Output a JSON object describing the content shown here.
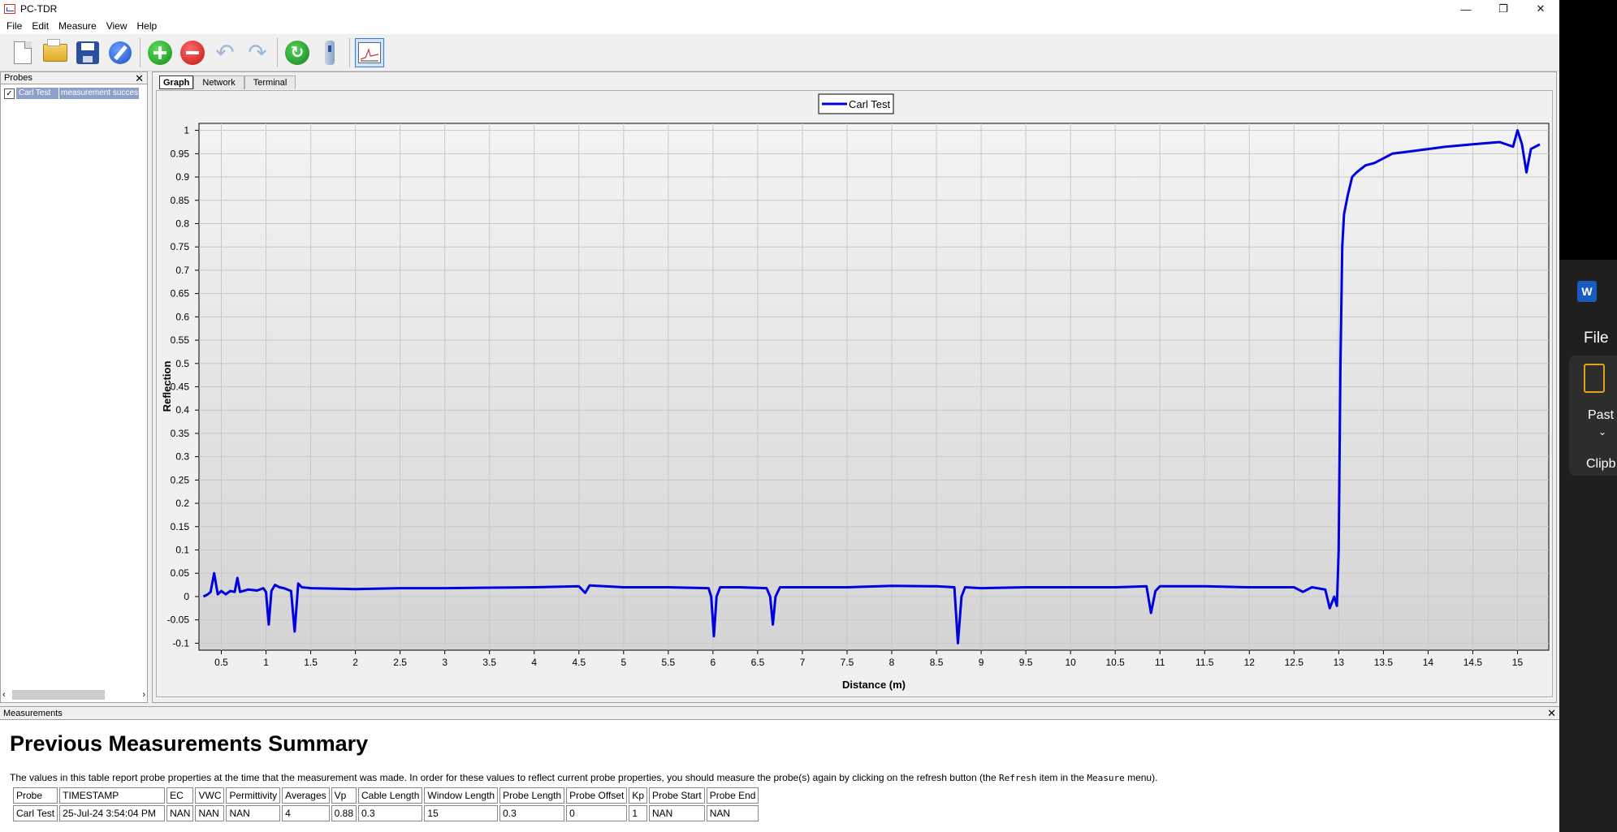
{
  "window": {
    "title": "PC-TDR",
    "controls": {
      "minimize": "—",
      "restore": "❐",
      "close": "✕"
    }
  },
  "menu": [
    "File",
    "Edit",
    "Measure",
    "View",
    "Help"
  ],
  "toolbar": {
    "icons": [
      "new-file-icon",
      "open-folder-icon",
      "save-icon",
      "edit-icon",
      "add-icon",
      "remove-icon",
      "undo-icon",
      "redo-icon",
      "refresh-icon",
      "probe-icon",
      "graph-icon"
    ]
  },
  "probes_panel": {
    "title": "Probes",
    "close": "✕",
    "rows": [
      {
        "name": "Carl Test",
        "status": "measurement successful",
        "checked": "✓"
      }
    ],
    "scroll_left": "‹",
    "scroll_right": "›"
  },
  "tabs": [
    {
      "label": "Graph",
      "active": true
    },
    {
      "label": "Network"
    },
    {
      "label": "Terminal"
    }
  ],
  "chart_data": {
    "type": "line",
    "xlabel": "Distance (m)",
    "ylabel": "Reflection",
    "xlim": [
      0.25,
      15.35
    ],
    "ylim": [
      -0.115,
      1.015
    ],
    "grid": true,
    "legend_position": "top-center",
    "x_ticks": [
      0.5,
      1,
      1.5,
      2,
      2.5,
      3,
      3.5,
      4,
      4.5,
      5,
      5.5,
      6,
      6.5,
      7,
      7.5,
      8,
      8.5,
      9,
      9.5,
      10,
      10.5,
      11,
      11.5,
      12,
      12.5,
      13,
      13.5,
      14,
      14.5,
      15
    ],
    "x_tick_labels": [
      "0.5",
      "1",
      "1.5",
      "2",
      "2.5",
      "3",
      "3.5",
      "4",
      "4.5",
      "5",
      "5.5",
      "6",
      "6.5",
      "7",
      "7.5",
      "8",
      "8.5",
      "9",
      "9.5",
      "10",
      "10.5",
      "11",
      "11.5",
      "12",
      "12.5",
      "13",
      "13.5",
      "14",
      "14.5",
      "15"
    ],
    "y_ticks": [
      -0.1,
      -0.05,
      0,
      0.05,
      0.1,
      0.15,
      0.2,
      0.25,
      0.3,
      0.35,
      0.4,
      0.45,
      0.5,
      0.55,
      0.6,
      0.65,
      0.7,
      0.75,
      0.8,
      0.85,
      0.9,
      0.95,
      1
    ],
    "y_tick_labels": [
      "-0.1",
      "-0.05",
      "0",
      "0.05",
      "0.1",
      "0.15",
      "0.2",
      "0.25",
      "0.3",
      "0.35",
      "0.4",
      "0.45",
      "0.5",
      "0.55",
      "0.6",
      "0.65",
      "0.7",
      "0.75",
      "0.8",
      "0.85",
      "0.9",
      "0.95",
      "1"
    ],
    "series": [
      {
        "name": "Carl Test",
        "color": "#0000e0",
        "points": [
          [
            0.3,
            0.0
          ],
          [
            0.35,
            0.005
          ],
          [
            0.38,
            0.01
          ],
          [
            0.42,
            0.05
          ],
          [
            0.46,
            0.005
          ],
          [
            0.5,
            0.012
          ],
          [
            0.55,
            0.005
          ],
          [
            0.6,
            0.012
          ],
          [
            0.65,
            0.01
          ],
          [
            0.68,
            0.04
          ],
          [
            0.71,
            0.01
          ],
          [
            0.8,
            0.015
          ],
          [
            0.9,
            0.013
          ],
          [
            0.97,
            0.018
          ],
          [
            1.0,
            0.01
          ],
          [
            1.03,
            -0.06
          ],
          [
            1.06,
            0.012
          ],
          [
            1.1,
            0.025
          ],
          [
            1.15,
            0.02
          ],
          [
            1.2,
            0.018
          ],
          [
            1.28,
            0.012
          ],
          [
            1.32,
            -0.075
          ],
          [
            1.36,
            0.028
          ],
          [
            1.4,
            0.02
          ],
          [
            1.5,
            0.018
          ],
          [
            2.0,
            0.016
          ],
          [
            2.5,
            0.018
          ],
          [
            3.0,
            0.018
          ],
          [
            3.5,
            0.019
          ],
          [
            4.0,
            0.02
          ],
          [
            4.5,
            0.022
          ],
          [
            4.57,
            0.008
          ],
          [
            4.62,
            0.024
          ],
          [
            5.0,
            0.02
          ],
          [
            5.5,
            0.02
          ],
          [
            5.95,
            0.018
          ],
          [
            5.98,
            0.0
          ],
          [
            6.01,
            -0.085
          ],
          [
            6.04,
            0.0
          ],
          [
            6.08,
            0.02
          ],
          [
            6.3,
            0.02
          ],
          [
            6.6,
            0.018
          ],
          [
            6.64,
            0.0
          ],
          [
            6.67,
            -0.06
          ],
          [
            6.7,
            0.0
          ],
          [
            6.75,
            0.02
          ],
          [
            7.0,
            0.02
          ],
          [
            7.5,
            0.02
          ],
          [
            8.0,
            0.023
          ],
          [
            8.5,
            0.022
          ],
          [
            8.7,
            0.02
          ],
          [
            8.74,
            -0.1
          ],
          [
            8.78,
            0.0
          ],
          [
            8.82,
            0.02
          ],
          [
            9.0,
            0.018
          ],
          [
            9.5,
            0.02
          ],
          [
            10.0,
            0.02
          ],
          [
            10.5,
            0.02
          ],
          [
            10.85,
            0.022
          ],
          [
            10.9,
            -0.035
          ],
          [
            10.95,
            0.012
          ],
          [
            11.0,
            0.022
          ],
          [
            11.5,
            0.022
          ],
          [
            12.0,
            0.02
          ],
          [
            12.5,
            0.02
          ],
          [
            12.6,
            0.01
          ],
          [
            12.7,
            0.02
          ],
          [
            12.85,
            0.015
          ],
          [
            12.9,
            -0.025
          ],
          [
            12.95,
            0.0
          ],
          [
            12.98,
            -0.02
          ],
          [
            13.0,
            0.1
          ],
          [
            13.02,
            0.5
          ],
          [
            13.04,
            0.75
          ],
          [
            13.06,
            0.82
          ],
          [
            13.1,
            0.86
          ],
          [
            13.15,
            0.9
          ],
          [
            13.2,
            0.91
          ],
          [
            13.3,
            0.925
          ],
          [
            13.4,
            0.93
          ],
          [
            13.5,
            0.94
          ],
          [
            13.6,
            0.95
          ],
          [
            13.8,
            0.955
          ],
          [
            14.0,
            0.96
          ],
          [
            14.2,
            0.965
          ],
          [
            14.5,
            0.97
          ],
          [
            14.8,
            0.975
          ],
          [
            14.95,
            0.965
          ],
          [
            15.0,
            1.0
          ],
          [
            15.05,
            0.97
          ],
          [
            15.1,
            0.91
          ],
          [
            15.15,
            0.96
          ],
          [
            15.25,
            0.97
          ]
        ]
      }
    ]
  },
  "measurements": {
    "title": "Measurements",
    "close": "✕",
    "heading": "Previous Measurements Summary",
    "note_pre": "The values in this table report probe properties at the time that the measurement was made. In order for these values to reflect current probe properties, you should measure the probe(s) again by clicking on the refresh button (the ",
    "note_refresh": "Refresh",
    "note_mid": " item in the ",
    "note_measure": "Measure",
    "note_post": " menu).",
    "columns": [
      "Probe",
      "TIMESTAMP",
      "EC",
      "VWC",
      "Permittivity",
      "Averages",
      "Vp",
      "Cable Length",
      "Window Length",
      "Probe Length",
      "Probe Offset",
      "Kp",
      "Probe Start",
      "Probe End"
    ],
    "rows": [
      [
        "Carl Test",
        "25-Jul-24 3:54:04 PM",
        "NAN",
        "NAN",
        "NAN",
        "4",
        "0.88",
        "0.3",
        "15",
        "0.3",
        "0",
        "1",
        "NAN",
        "NAN"
      ]
    ]
  },
  "word_fragment": {
    "logo": "W",
    "file": "File",
    "paste": "Past",
    "chevron": "⌄",
    "clipboard": "Clipb"
  }
}
